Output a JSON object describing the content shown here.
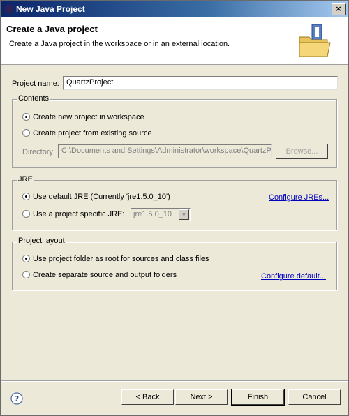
{
  "window": {
    "title": "New Java Project",
    "close_glyph": "×"
  },
  "banner": {
    "title": "Create a Java project",
    "subtitle": "Create a Java project in the workspace or in an external location."
  },
  "project_name": {
    "label": "Project name:",
    "value": "QuartzProject"
  },
  "contents": {
    "legend": "Contents",
    "option_new": "Create new project in workspace",
    "option_existing": "Create project from existing source",
    "directory_label": "Directory:",
    "directory_value": "C:\\Documents and Settings\\Administrator\\workspace\\QuartzP",
    "browse": "Browse..."
  },
  "jre": {
    "legend": "JRE",
    "option_default": "Use default JRE (Currently 'jre1.5.0_10')",
    "option_specific": "Use a project specific JRE:",
    "specific_value": "jre1.5.0_10",
    "configure": "Configure JREs..."
  },
  "layout": {
    "legend": "Project layout",
    "option_root": "Use project folder as root for sources and class files",
    "option_separate": "Create separate source and output folders",
    "configure": "Configure default..."
  },
  "buttons": {
    "back": "< Back",
    "next": "Next >",
    "finish": "Finish",
    "cancel": "Cancel"
  },
  "colors": {
    "title_bar": "#0a246a",
    "link": "#0000c0",
    "dialog_bg": "#ece9d8"
  }
}
